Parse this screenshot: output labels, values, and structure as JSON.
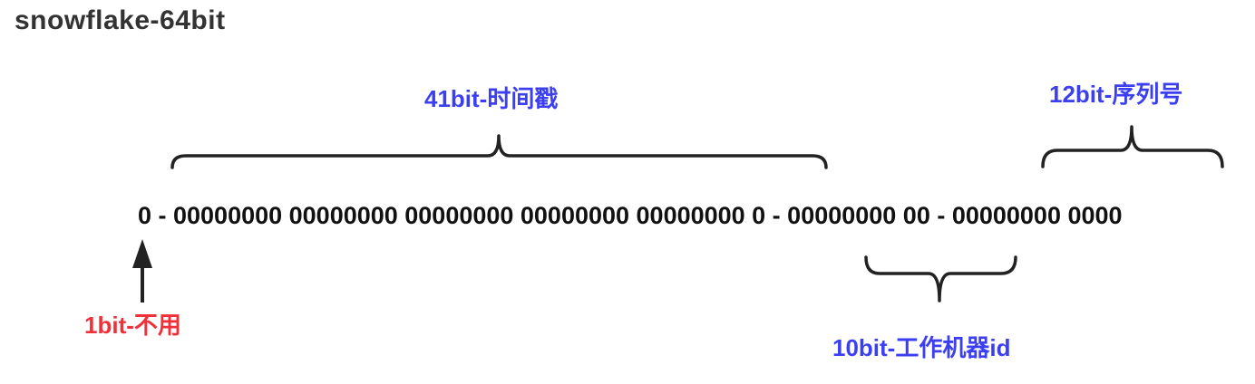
{
  "title": "snowflake-64bit",
  "bits_row": "0 - 00000000 00000000 00000000 00000000 00000000 0 - 00000000 00 - 00000000 0000",
  "segments": {
    "sign": {
      "label": "1bit-不用",
      "color": "#f0313a"
    },
    "timestamp": {
      "label": "41bit-时间戳",
      "color": "#3b3ff0"
    },
    "worker": {
      "label": "10bit-工作机器id",
      "color": "#3b3ff0"
    },
    "sequence": {
      "label": "12bit-序列号",
      "color": "#3b3ff0"
    }
  },
  "colors": {
    "brace": "#222222",
    "arrow": "#222222"
  }
}
